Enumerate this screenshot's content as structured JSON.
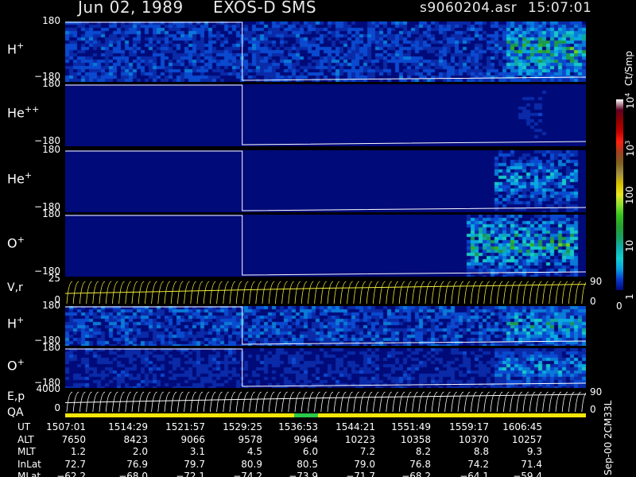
{
  "header": {
    "date": "Jun 02, 1989",
    "instrument": "EXOS-D SMS",
    "file": "s9060204.asr",
    "time": "15:07:01"
  },
  "colors": {
    "background": "#000000",
    "panel_background": "#000a78",
    "trace": "#ffffff",
    "qa_bar": "#f5e60a",
    "qa_green": "#2cc84a",
    "line_panel_trace": "#f2ee3a"
  },
  "chart_data": [
    {
      "type": "heatmap",
      "name": "H+ pitch-angle spectrogram",
      "label_main": "H",
      "label_sup": "+",
      "ytick_top": "180",
      "ytick_bottom": "−180",
      "ylim": [
        -180,
        180
      ],
      "activity": [
        [
          0.84,
          1.0,
          0.9
        ]
      ],
      "base_level": 0.45
    },
    {
      "type": "heatmap",
      "name": "He++ pitch-angle spectrogram",
      "label_main": "He",
      "label_sup": "++",
      "ytick_top": "180",
      "ytick_bottom": "−180",
      "ylim": [
        -180,
        180
      ],
      "activity": [
        [
          0.87,
          0.92,
          0.2
        ]
      ],
      "base_level": 0.0
    },
    {
      "type": "heatmap",
      "name": "He+ pitch-angle spectrogram",
      "label_main": "He",
      "label_sup": "+",
      "ytick_top": "180",
      "ytick_bottom": "−180",
      "ylim": [
        -180,
        180
      ],
      "activity": [
        [
          0.82,
          0.98,
          0.55
        ]
      ],
      "base_level": 0.0
    },
    {
      "type": "heatmap",
      "name": "O+ pitch-angle spectrogram",
      "label_main": "O",
      "label_sup": "+",
      "ytick_top": "180",
      "ytick_bottom": "−180",
      "ylim": [
        -180,
        180
      ],
      "activity": [
        [
          0.77,
          0.98,
          0.85
        ]
      ],
      "base_level": 0.0
    },
    {
      "type": "line",
      "name": "V,r sweep panel",
      "label": "V,r",
      "ytick_top": "25",
      "ytick_bottom": "0",
      "ytick_right": "90",
      "ytick_right_bottom": "0",
      "ylim": [
        0,
        25
      ]
    },
    {
      "type": "heatmap",
      "name": "H+ energy spectrogram",
      "label_main": "H",
      "label_sup": "+",
      "ytick_top": "180",
      "ytick_bottom": "−180",
      "ylim": [
        -180,
        180
      ],
      "activity": [
        [
          0.84,
          1.0,
          0.75
        ]
      ],
      "base_level": 0.5
    },
    {
      "type": "heatmap",
      "name": "O+ energy spectrogram",
      "label_main": "O",
      "label_sup": "+",
      "ytick_top": "180",
      "ytick_bottom": "−180",
      "ylim": [
        -180,
        180
      ],
      "activity": [
        [
          0.82,
          1.0,
          0.55
        ]
      ],
      "base_level": 0.3
    },
    {
      "type": "line",
      "name": "E,p sweep panel",
      "label": "E,p",
      "ytick_top": "4000",
      "ytick_bottom": "0",
      "ytick_right": "90",
      "ytick_right_bottom": "0",
      "ylim": [
        0,
        4000
      ]
    }
  ],
  "qa": {
    "label": "QA",
    "green_range": [
      0.44,
      0.485
    ]
  },
  "colorbar": {
    "unit": "Ct/Smp",
    "ticks": [
      {
        "value_text": "10",
        "sup": "4",
        "pos": 1.0
      },
      {
        "value_text": "10",
        "sup": "3",
        "pos": 0.75
      },
      {
        "value_text": "100",
        "sup": "",
        "pos": 0.5
      },
      {
        "value_text": "10",
        "sup": "",
        "pos": 0.25
      },
      {
        "value_text": "1",
        "sup": "",
        "pos": 0.0
      }
    ],
    "bottom_label": "0",
    "stops": [
      "#000a78",
      "#0a3ad0",
      "#0aa0e0",
      "#11d0d0",
      "#10b0b0",
      "#1aa060",
      "#25a030",
      "#33c020",
      "#88e030",
      "#e8e820",
      "#d8c000",
      "#a09040",
      "#806020",
      "#a04020",
      "#ff2010",
      "#c00000",
      "#900000",
      "#600020",
      "#ffffff"
    ]
  },
  "side_date": "Sep-00 2CM33L",
  "table": {
    "rows": [
      {
        "label": "UT",
        "values": [
          "1507:01",
          "1514:29",
          "1521:57",
          "1529:25",
          "1536:53",
          "1544:21",
          "1551:49",
          "1559:17",
          "1606:45"
        ]
      },
      {
        "label": "ALT",
        "values": [
          "7650",
          "8423",
          "9066",
          "9578",
          "9964",
          "10223",
          "10358",
          "10370",
          "10257"
        ]
      },
      {
        "label": "MLT",
        "values": [
          "1.2",
          "2.0",
          "3.1",
          "4.5",
          "6.0",
          "7.2",
          "8.2",
          "8.8",
          "9.3"
        ]
      },
      {
        "label": "InLat",
        "values": [
          "72.7",
          "76.9",
          "79.7",
          "80.9",
          "80.5",
          "79.0",
          "76.8",
          "74.2",
          "71.4"
        ]
      },
      {
        "label": "MLat",
        "values": [
          "−62.2",
          "−68.0",
          "−72.1",
          "−74.2",
          "−73.9",
          "−71.7",
          "−68.2",
          "−64.1",
          "−59.4"
        ]
      }
    ]
  }
}
